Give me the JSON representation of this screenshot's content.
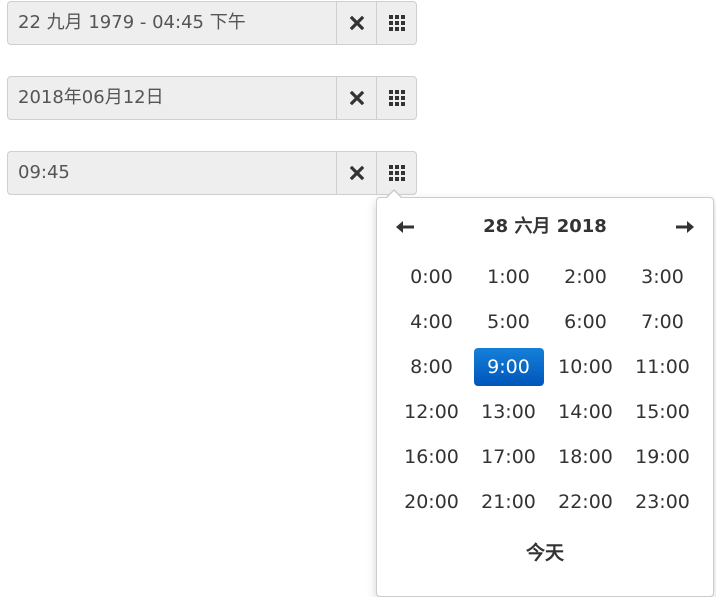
{
  "inputs": [
    {
      "value": "22 九月 1979 - 04:45 下午"
    },
    {
      "value": "2018年06月12日"
    },
    {
      "value": "09:45"
    }
  ],
  "icons": {
    "clear": "close-icon",
    "toggle": "grid-icon",
    "prev": "arrow-left-icon",
    "next": "arrow-right-icon"
  },
  "picker": {
    "title": "28 六月 2018",
    "hours": [
      "0:00",
      "1:00",
      "2:00",
      "3:00",
      "4:00",
      "5:00",
      "6:00",
      "7:00",
      "8:00",
      "9:00",
      "10:00",
      "11:00",
      "12:00",
      "13:00",
      "14:00",
      "15:00",
      "16:00",
      "17:00",
      "18:00",
      "19:00",
      "20:00",
      "21:00",
      "22:00",
      "23:00"
    ],
    "selected_hour": "9:00",
    "today_label": "今天"
  },
  "colors": {
    "accent": "#0055bb",
    "accent_light": "#1580d8"
  }
}
